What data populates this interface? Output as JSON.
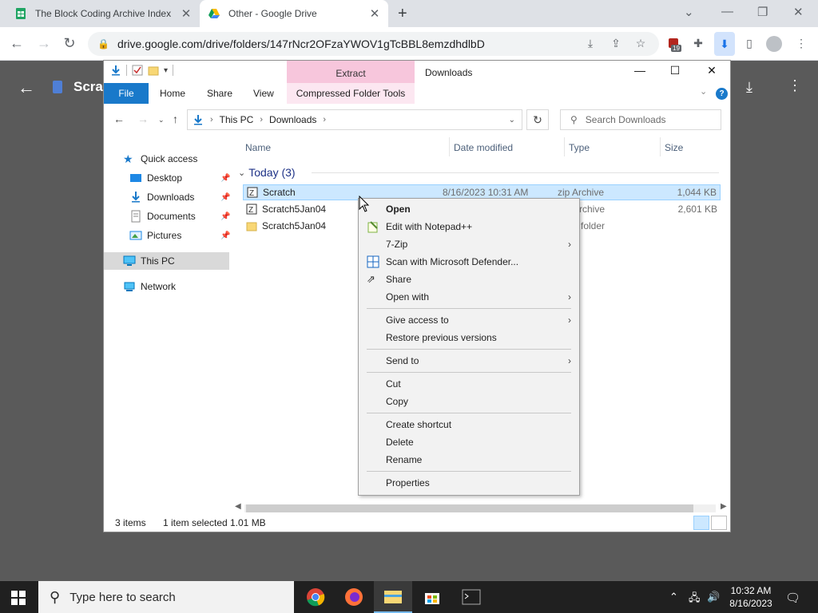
{
  "chrome": {
    "tabs": [
      {
        "title": "The Block Coding Archive Index",
        "close": "✕"
      },
      {
        "title": "Other - Google Drive",
        "close": "✕"
      }
    ],
    "new_tab": "+",
    "url": "drive.google.com/drive/folders/147rNcr2OFzaYWOV1gTcBBL8emzdhdlbD",
    "extension_badge": "19"
  },
  "drive": {
    "title_partial": "Scrat"
  },
  "explorer": {
    "caption": "Downloads",
    "extract_tab": "Extract",
    "ribbon_tabs": {
      "file": "File",
      "home": "Home",
      "share": "Share",
      "view": "View",
      "compressed": "Compressed Folder Tools"
    },
    "address": {
      "root": "This PC",
      "folder": "Downloads"
    },
    "search_placeholder": "Search Downloads",
    "nav": {
      "quick_access": "Quick access",
      "desktop": "Desktop",
      "downloads": "Downloads",
      "documents": "Documents",
      "pictures": "Pictures",
      "this_pc": "This PC",
      "network": "Network"
    },
    "columns": {
      "name": "Name",
      "date": "Date modified",
      "type": "Type",
      "size": "Size"
    },
    "group_label": "Today (3)",
    "files": [
      {
        "name": "Scratch",
        "date": "8/16/2023 10:31 AM",
        "type": "zip Archive",
        "size": "1,044 KB"
      },
      {
        "name": "Scratch5Jan04",
        "date": "",
        "type": "Archive",
        "size": "2,601 KB"
      },
      {
        "name": "Scratch5Jan04",
        "date": "",
        "type": "e folder",
        "size": ""
      }
    ],
    "status": {
      "count": "3 items",
      "selected": "1 item selected",
      "size": "1.01 MB"
    }
  },
  "context_menu": {
    "open": "Open",
    "edit_notepad": "Edit with Notepad++",
    "seven_zip": "7-Zip",
    "defender": "Scan with Microsoft Defender...",
    "share": "Share",
    "open_with": "Open with",
    "give_access": "Give access to",
    "restore": "Restore previous versions",
    "send_to": "Send to",
    "cut": "Cut",
    "copy": "Copy",
    "create_shortcut": "Create shortcut",
    "delete": "Delete",
    "rename": "Rename",
    "properties": "Properties"
  },
  "taskbar": {
    "search_placeholder": "Type here to search",
    "time": "10:32 AM",
    "date": "8/16/2023"
  },
  "colors": {
    "ribbon_file": "#1979ca",
    "extract_pink": "#f7c6dc",
    "selection": "#cce8ff",
    "taskbar": "#202020"
  }
}
